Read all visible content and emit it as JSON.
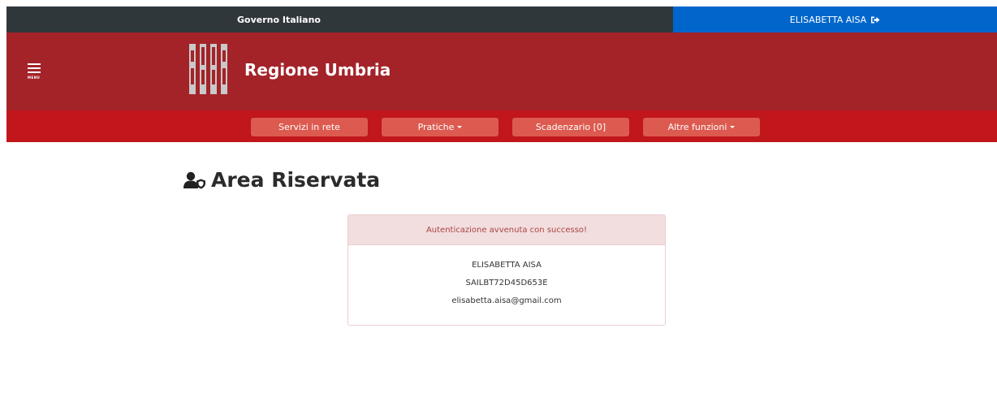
{
  "topbar": {
    "gov_label": "Governo Italiano",
    "user_label": "ELISABETTA AISA"
  },
  "header": {
    "menu_label": "MENU",
    "region_name": "Regione Umbria"
  },
  "nav": {
    "items": [
      {
        "label": "Servizi in rete",
        "dropdown": false
      },
      {
        "label": "Pratiche",
        "dropdown": true
      },
      {
        "label": "Scadenzario [0]",
        "dropdown": false
      },
      {
        "label": "Altre funzioni",
        "dropdown": true
      }
    ]
  },
  "main": {
    "title": "Area Riservata",
    "title_icon": "user-shield-icon"
  },
  "panel": {
    "heading": "Autenticazione avvenuta con successo!",
    "name": "ELISABETTA AISA",
    "fiscal_code": "SAILBT72D45D653E",
    "email": "elisabetta.aisa@gmail.com"
  },
  "colors": {
    "gov_bar": "#30373b",
    "user_bar": "#0066cc",
    "header": "#a32329",
    "navbar": "#c0161c",
    "nav_button": "#dc5a4f",
    "alert_bg": "#f2dede",
    "alert_text": "#a94442"
  }
}
